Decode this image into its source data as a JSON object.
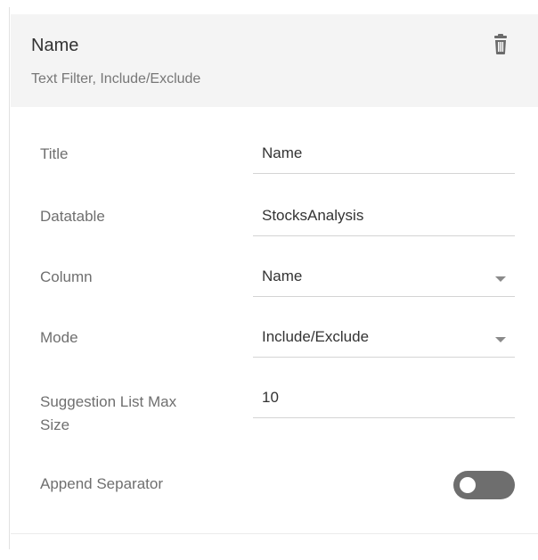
{
  "header": {
    "title": "Name",
    "subtitle": "Text Filter, Include/Exclude"
  },
  "fields": {
    "title": {
      "label": "Title",
      "value": "Name"
    },
    "datatable": {
      "label": "Datatable",
      "value": "StocksAnalysis"
    },
    "column": {
      "label": "Column",
      "value": "Name"
    },
    "mode": {
      "label": "Mode",
      "value": "Include/Exclude"
    },
    "suggestion_max": {
      "label_line1": "Suggestion List Max",
      "label_line2": "Size",
      "value": "10"
    },
    "append_separator": {
      "label": "Append Separator",
      "state": "off"
    }
  },
  "icons": {
    "delete": "trash-icon",
    "dropdown": "chevron-down-icon"
  },
  "colors": {
    "header_bg": "#f4f4f4",
    "toggle_off": "#6e6e6e"
  }
}
